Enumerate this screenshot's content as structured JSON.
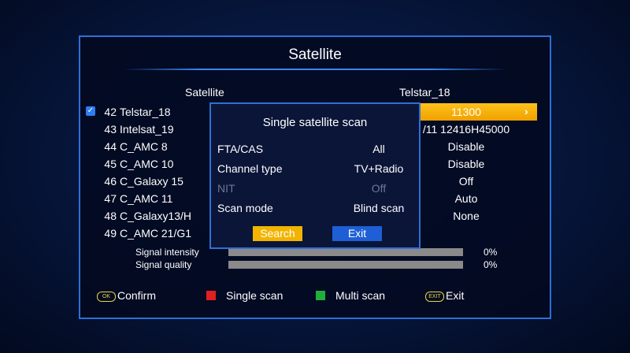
{
  "header": {
    "title": "Satellite"
  },
  "columns": {
    "left": "Satellite",
    "right": "Telstar_18"
  },
  "satellites": [
    {
      "num": "42",
      "name": "Telstar_18",
      "checked": true
    },
    {
      "num": "43",
      "name": "Intelsat_19"
    },
    {
      "num": "44",
      "name": "C_AMC 8"
    },
    {
      "num": "45",
      "name": "C_AMC 10"
    },
    {
      "num": "46",
      "name": "C_Galaxy 15"
    },
    {
      "num": "47",
      "name": "C_AMC 11"
    },
    {
      "num": "48",
      "name": "C_Galaxy13/H"
    },
    {
      "num": "49",
      "name": "C_AMC 21/G1"
    }
  ],
  "params": [
    {
      "value": "11300"
    },
    {
      "value": "/11 12416H45000"
    },
    {
      "value": "Disable"
    },
    {
      "value": "Disable"
    },
    {
      "value": "Off"
    },
    {
      "value": "Auto"
    },
    {
      "value": "None"
    }
  ],
  "signal": {
    "intensity_label": "Signal intensity",
    "intensity_value": "0%",
    "intensity_level": 0,
    "quality_label": "Signal quality",
    "quality_value": "0%",
    "quality_level": 0
  },
  "footer": {
    "ok_key": "OK",
    "confirm": "Confirm",
    "single_scan": "Single scan",
    "multi_scan": "Multi scan",
    "exit_key": "EXIT",
    "exit": "Exit",
    "red": "#e02020",
    "green": "#1fae3a"
  },
  "dialog": {
    "title": "Single satellite scan",
    "rows": [
      {
        "label": "FTA/CAS",
        "value": "All"
      },
      {
        "label": "Channel type",
        "value": "TV+Radio"
      },
      {
        "label": "NIT",
        "value": "Off",
        "disabled": true
      },
      {
        "label": "Scan mode",
        "value": "Blind scan"
      }
    ],
    "search_label": "Search",
    "exit_label": "Exit"
  }
}
